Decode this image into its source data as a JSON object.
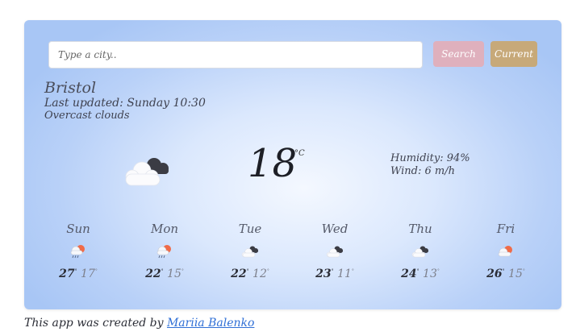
{
  "search": {
    "placeholder": "Type a city..",
    "button": "Search",
    "current_button": "Current"
  },
  "current": {
    "city": "Bristol",
    "updated_label": "Last updated: ",
    "updated_time": "Sunday 10:30",
    "description": "Overcast clouds",
    "icon": "broken-clouds-icon",
    "temperature": "18",
    "unit": "°C",
    "humidity_label": "Humidity: ",
    "humidity": "94%",
    "wind_label": "Wind: ",
    "wind": "6 m/h"
  },
  "forecast": [
    {
      "day": "Sun",
      "icon": "rain-sun-icon",
      "max": "27",
      "min": "17"
    },
    {
      "day": "Mon",
      "icon": "rain-sun-icon",
      "max": "22",
      "min": "15"
    },
    {
      "day": "Tue",
      "icon": "broken-clouds-icon",
      "max": "22",
      "min": "12"
    },
    {
      "day": "Wed",
      "icon": "broken-clouds-icon",
      "max": "23",
      "min": "11"
    },
    {
      "day": "Thu",
      "icon": "broken-clouds-icon",
      "max": "24",
      "min": "13"
    },
    {
      "day": "Fri",
      "icon": "sun-cloud-icon",
      "max": "26",
      "min": "15"
    }
  ],
  "footer": {
    "text": "This app was created by ",
    "author": "Mariia Balenko"
  },
  "colors": {
    "search_button": "#dfb0bd",
    "current_button": "#c7a979",
    "card_edge": "#a8c6f5"
  }
}
